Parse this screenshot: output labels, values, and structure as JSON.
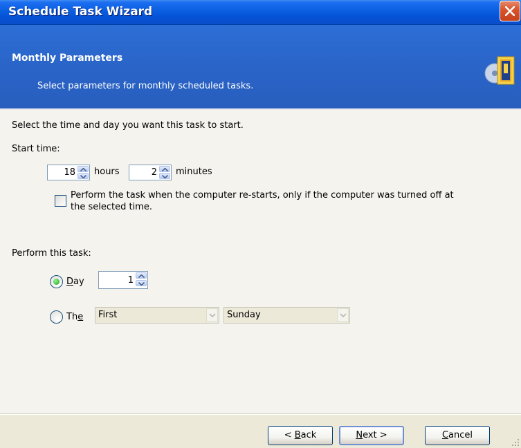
{
  "window": {
    "title": "Schedule Task Wizard"
  },
  "header": {
    "title": "Monthly Parameters",
    "subtitle": "Select parameters for monthly scheduled tasks."
  },
  "content": {
    "instruction": "Select the time and day you want this task to start.",
    "start_time_label": "Start time:",
    "hours_value": "18",
    "hours_label": "hours",
    "minutes_value": "2",
    "minutes_label": "minutes",
    "restart_option": {
      "line1": "Perform the task when the computer re-starts, only if the computer was turned off at",
      "line2": "the selected time.",
      "checked": false
    },
    "perform_label": "Perform this task:",
    "day_option": {
      "label_hotkey": "D",
      "label_rest": "ay",
      "selected": true,
      "value": "1"
    },
    "the_option": {
      "label_pre": "Th",
      "label_hotkey": "e",
      "selected": false,
      "week_value": "First",
      "day_value": "Sunday"
    }
  },
  "footer": {
    "back_pre": "< ",
    "back_hotkey": "B",
    "back_rest": "ack",
    "next_hotkey": "N",
    "next_rest": "ext >",
    "cancel_hotkey": "C",
    "cancel_rest": "ancel"
  },
  "icons": {
    "close": "close-icon",
    "wizard": "wizard-icon",
    "spin_up": "spin-up-icon",
    "spin_down": "spin-down-icon",
    "combo_arrow": "chevron-down-icon",
    "resize_grip": "resize-grip-icon"
  },
  "colors": {
    "title_bar": "#0a5ee0",
    "header_bg": "#2a64c8",
    "content_bg": "#f4f3ee",
    "close_button": "#d8562e",
    "radio_selected": "#21a121"
  }
}
